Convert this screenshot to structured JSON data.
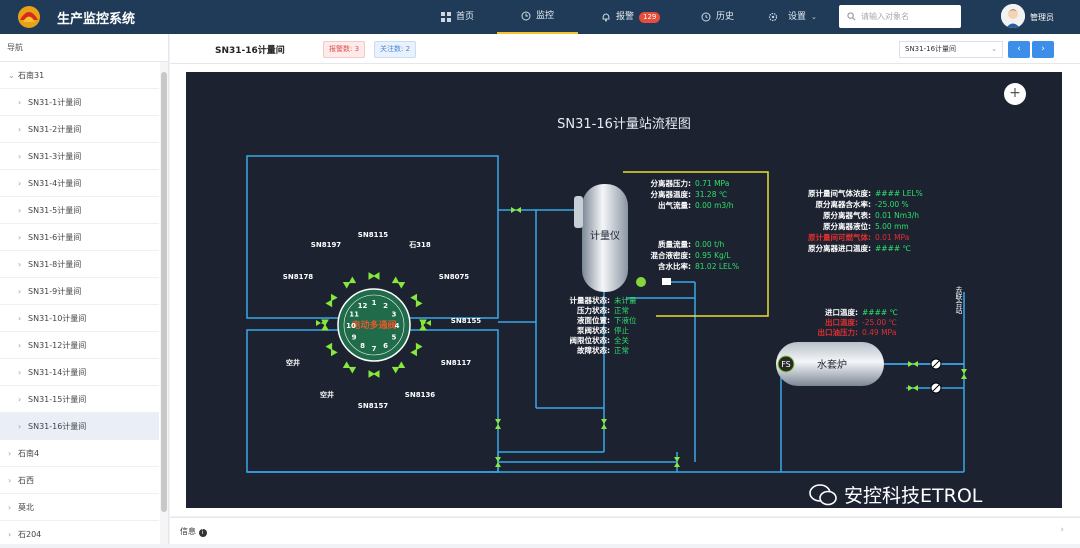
{
  "header": {
    "app_title": "生产监控系统",
    "nav": [
      {
        "label": "首页",
        "icon": "grid-icon"
      },
      {
        "label": "监控",
        "icon": "clock-icon",
        "active": true
      },
      {
        "label": "报警",
        "icon": "bell-icon",
        "badge": "129"
      },
      {
        "label": "历史",
        "icon": "history-icon"
      },
      {
        "label": "设置",
        "icon": "gear-icon"
      }
    ],
    "search_placeholder": "请输入对象名",
    "user_name": "管理员"
  },
  "sidebar": {
    "title": "导航",
    "items": [
      {
        "label": "石南31",
        "level": 0,
        "expanded": true
      },
      {
        "label": "SN31-1计量间",
        "level": 1
      },
      {
        "label": "SN31-2计量间",
        "level": 1
      },
      {
        "label": "SN31-3计量间",
        "level": 1
      },
      {
        "label": "SN31-4计量间",
        "level": 1
      },
      {
        "label": "SN31-5计量间",
        "level": 1
      },
      {
        "label": "SN31-6计量间",
        "level": 1
      },
      {
        "label": "SN31-8计量间",
        "level": 1
      },
      {
        "label": "SN31-9计量间",
        "level": 1
      },
      {
        "label": "SN31-10计量间",
        "level": 1
      },
      {
        "label": "SN31-12计量间",
        "level": 1
      },
      {
        "label": "SN31-14计量间",
        "level": 1
      },
      {
        "label": "SN31-15计量间",
        "level": 1
      },
      {
        "label": "SN31-16计量间",
        "level": 1,
        "active": true
      },
      {
        "label": "石南4",
        "level": 0
      },
      {
        "label": "石西",
        "level": 0
      },
      {
        "label": "莫北",
        "level": 0
      },
      {
        "label": "石204",
        "level": 0
      }
    ]
  },
  "topbar": {
    "station_title": "SN31-16计量间",
    "alarm_tag": "报警数: 3",
    "watch_tag": "关注数: 2",
    "select_value": "SN31-16计量间",
    "prev_label": "‹",
    "next_label": "›"
  },
  "diagram": {
    "title": "SN31-16计量站流程图",
    "meter_label": "计量仪",
    "heater_label": "水套炉",
    "fs_label": "FS",
    "valve_center_label": "电动多通阀",
    "port_numbers": [
      "1",
      "2",
      "3",
      "4",
      "5",
      "6",
      "7",
      "8",
      "9",
      "10",
      "11",
      "12"
    ],
    "wells": [
      "SN8197",
      "SN8115",
      "石318",
      "SN8178",
      "SN8075",
      "SN8155",
      "空井",
      "SN8117",
      "空井",
      "SN8157",
      "SN8136"
    ],
    "meter_readings": [
      {
        "label": "分离器压力:",
        "value": "0.71 MPa"
      },
      {
        "label": "分离器温度:",
        "value": "31.28 ℃"
      },
      {
        "label": "出气流量:",
        "value": "0.00 m3/h"
      },
      {
        "label": "质量流量:",
        "value": "0.00 t/h"
      },
      {
        "label": "混合液密度:",
        "value": "0.95 Kg/L"
      },
      {
        "label": "含水比率:",
        "value": "81.02 LEL%"
      }
    ],
    "meter_status": [
      {
        "label": "计量器状态:",
        "value": "未计量"
      },
      {
        "label": "压力状态:",
        "value": "正常"
      },
      {
        "label": "液面位置:",
        "value": "下液位"
      },
      {
        "label": "泵阀状态:",
        "value": "停止"
      },
      {
        "label": "阀限位状态:",
        "value": "全关"
      },
      {
        "label": "故障状态:",
        "value": "正常"
      }
    ],
    "right_readings": [
      {
        "label": "原计量间气体浓度:",
        "value": "#### LEL%",
        "alarm": false
      },
      {
        "label": "原分离器含水率:",
        "value": "-25.00 %",
        "alarm": false
      },
      {
        "label": "原分离器气表:",
        "value": "0.01 Nm3/h",
        "alarm": false
      },
      {
        "label": "原分离器液位:",
        "value": "5.00 mm",
        "alarm": false
      },
      {
        "label": "原计量间可燃气体:",
        "value": "0.01 MPa",
        "alarm": true
      },
      {
        "label": "原分离器进口温度:",
        "value": "#### ℃",
        "alarm": false
      }
    ],
    "heater_readings": [
      {
        "label": "进口温度:",
        "value": "#### ℃",
        "alarm": false
      },
      {
        "label": "出口温度:",
        "value": "-25.00 ℃",
        "alarm": true
      },
      {
        "label": "出口油压力:",
        "value": "0.49 MPa",
        "alarm": true
      }
    ],
    "outlet_label": "去联合站"
  },
  "bottom": {
    "info_label": "信息",
    "watermark": "安控科技ETROL"
  },
  "colors": {
    "header_bg": "#1f3b57",
    "canvas_bg": "#1c2230",
    "pipe": "#38a8e8",
    "value_green": "#2ce06a",
    "alarm_red": "#e03030",
    "frame_yellow": "#e8e030"
  }
}
